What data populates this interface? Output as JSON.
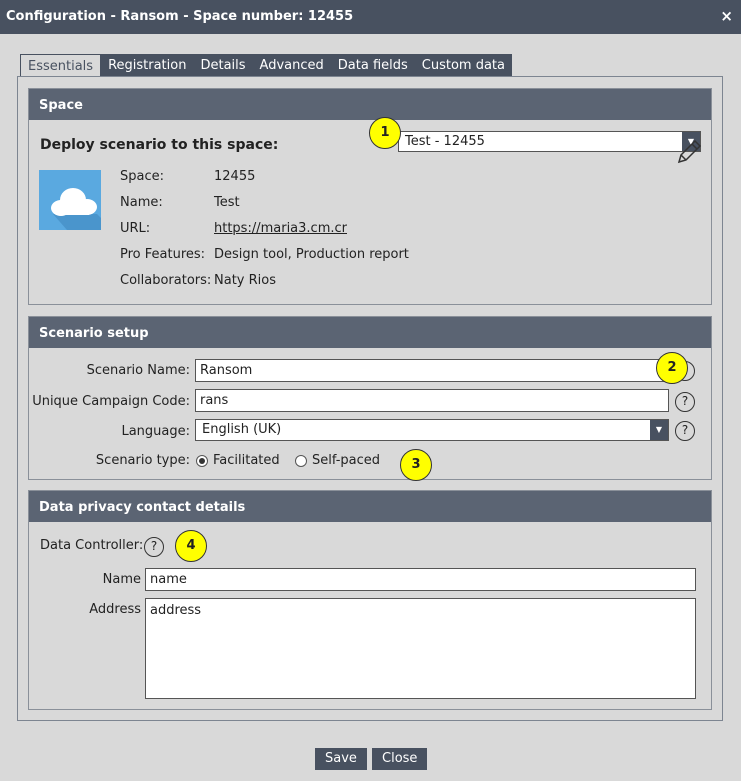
{
  "window": {
    "title": "Configuration - Ransom - Space number: 12455",
    "close_label": "×"
  },
  "tabs": [
    {
      "label": "Essentials"
    },
    {
      "label": "Registration"
    },
    {
      "label": "Details"
    },
    {
      "label": "Advanced"
    },
    {
      "label": "Data fields"
    },
    {
      "label": "Custom data"
    }
  ],
  "space": {
    "heading": "Space",
    "deploy_label": "Deploy scenario to this space:",
    "deploy_select_value": "Test - 12455",
    "info": {
      "space_label": "Space:",
      "space_value": "12455",
      "name_label": "Name:",
      "name_value": "Test",
      "url_label": "URL:",
      "url_value": "https://maria3.cm.cr",
      "pro_label": "Pro Features:",
      "pro_value": "Design tool, Production report",
      "collab_label": "Collaborators:",
      "collab_value": "Naty Rios"
    }
  },
  "scenario": {
    "heading": "Scenario setup",
    "name_label": "Scenario Name:",
    "name_value": "Ransom",
    "code_label": "Unique Campaign Code:",
    "code_value": "rans",
    "language_label": "Language:",
    "language_value": "English (UK)",
    "type_label": "Scenario type:",
    "type_options": [
      {
        "label": "Facilitated",
        "checked": true
      },
      {
        "label": "Self-paced",
        "checked": false
      }
    ],
    "help_glyph": "?"
  },
  "privacy": {
    "heading": "Data privacy contact details",
    "controller_label": "Data Controller:",
    "name_label": "Name",
    "name_value": "name",
    "address_label": "Address",
    "address_value": "address"
  },
  "callouts": [
    "1",
    "2",
    "3",
    "4"
  ],
  "buttons": {
    "save": "Save",
    "close": "Close"
  },
  "icons": {
    "dropdown": "chevron-down-icon",
    "help": "help-circle-icon",
    "edit": "pencil-icon",
    "space": "cloud-icon"
  },
  "colors": {
    "titlebar": "#485160",
    "section_header": "#5b6473",
    "callout": "#ffff00",
    "background": "#d9d9d9"
  }
}
